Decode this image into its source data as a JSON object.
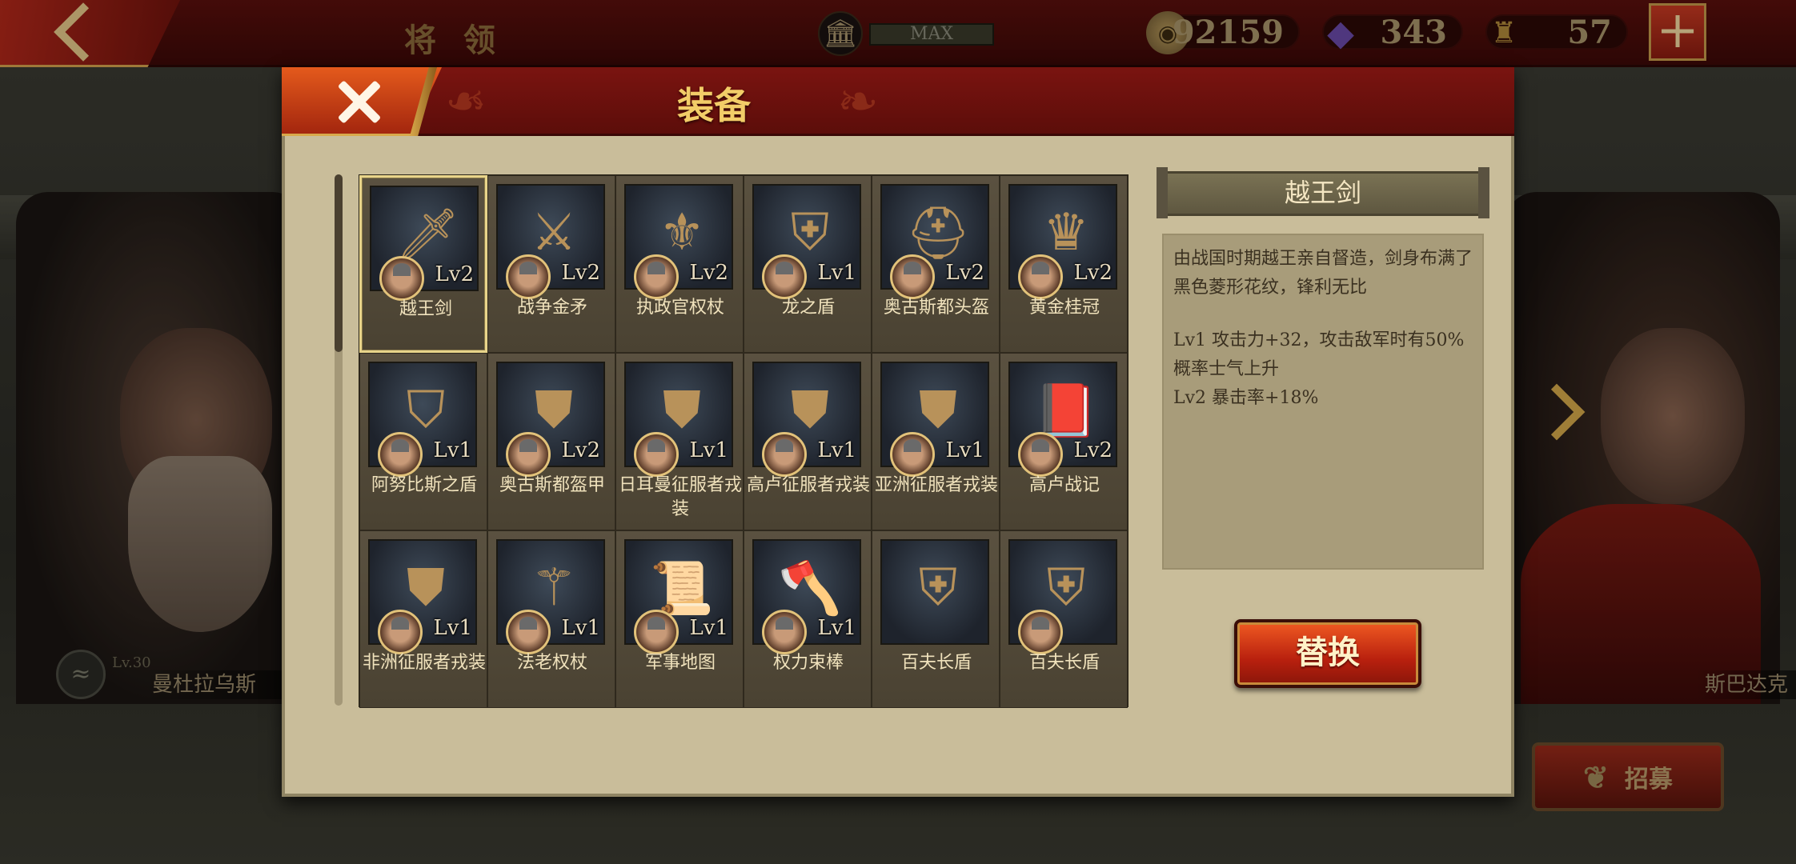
{
  "topbar": {
    "page_title": "将 领",
    "vip_label": "MAX",
    "coins": "92159",
    "gems": "343",
    "tokens": "57",
    "back_icon": "chevron-left-icon",
    "plus_icon": "plus-icon"
  },
  "background": {
    "left_hero_name": "曼杜拉乌斯",
    "left_hero_level": "Lv.30",
    "right_hero_name": "斯巴达克",
    "recruit_label": "招募"
  },
  "dialog": {
    "title": "装备",
    "selected_index": 0,
    "items": [
      {
        "name": "越王剑",
        "level": "Lv2",
        "icon": "sword-icon",
        "glyph": "🗡"
      },
      {
        "name": "战争金矛",
        "level": "Lv2",
        "icon": "spear-icon",
        "glyph": "⚔"
      },
      {
        "name": "执政官权杖",
        "level": "Lv2",
        "icon": "eagle-scepter-icon",
        "glyph": "⚜"
      },
      {
        "name": "龙之盾",
        "level": "Lv1",
        "icon": "dragon-shield-icon",
        "glyph": "⛨"
      },
      {
        "name": "奥古斯都头盔",
        "level": "Lv2",
        "icon": "helmet-icon",
        "glyph": "⛑"
      },
      {
        "name": "黄金桂冠",
        "level": "Lv2",
        "icon": "laurel-crown-icon",
        "glyph": "♛"
      },
      {
        "name": "阿努比斯之盾",
        "level": "Lv1",
        "icon": "anubis-shield-icon",
        "glyph": "⛉"
      },
      {
        "name": "奥古斯都盔甲",
        "level": "Lv2",
        "icon": "armor-icon",
        "glyph": "⛊"
      },
      {
        "name": "日耳曼征服者戎装",
        "level": "Lv1",
        "icon": "germanic-armor-icon",
        "glyph": "⛊"
      },
      {
        "name": "高卢征服者戎装",
        "level": "Lv1",
        "icon": "gallic-armor-icon",
        "glyph": "⛊"
      },
      {
        "name": "亚洲征服者戎装",
        "level": "Lv1",
        "icon": "asian-armor-icon",
        "glyph": "⛊"
      },
      {
        "name": "高卢战记",
        "level": "Lv2",
        "icon": "book-icon",
        "glyph": "📕"
      },
      {
        "name": "非洲征服者戎装",
        "level": "Lv1",
        "icon": "african-armor-icon",
        "glyph": "⛊"
      },
      {
        "name": "法老权杖",
        "level": "Lv1",
        "icon": "pharaoh-scepter-icon",
        "glyph": "⚚"
      },
      {
        "name": "军事地图",
        "level": "Lv1",
        "icon": "map-scroll-icon",
        "glyph": "📜"
      },
      {
        "name": "权力束棒",
        "level": "Lv1",
        "icon": "fasces-icon",
        "glyph": "🪓"
      },
      {
        "name": "百夫长盾",
        "level": "",
        "icon": "scutum-shield-icon",
        "glyph": "⛨",
        "portrait": false
      },
      {
        "name": "百夫长盾",
        "level": "",
        "icon": "scutum-shield-icon",
        "glyph": "⛨",
        "portrait": true
      }
    ],
    "detail": {
      "name": "越王剑",
      "description": "由战国时期越王亲自督造，剑身布满了黑色菱形花纹，锋利无比",
      "level1": "Lv1  攻击力+32，攻击敌军时有50%概率士气上升",
      "level2": "Lv2  暴击率+18%"
    },
    "replace_label": "替换",
    "close_icon": "close-icon"
  }
}
